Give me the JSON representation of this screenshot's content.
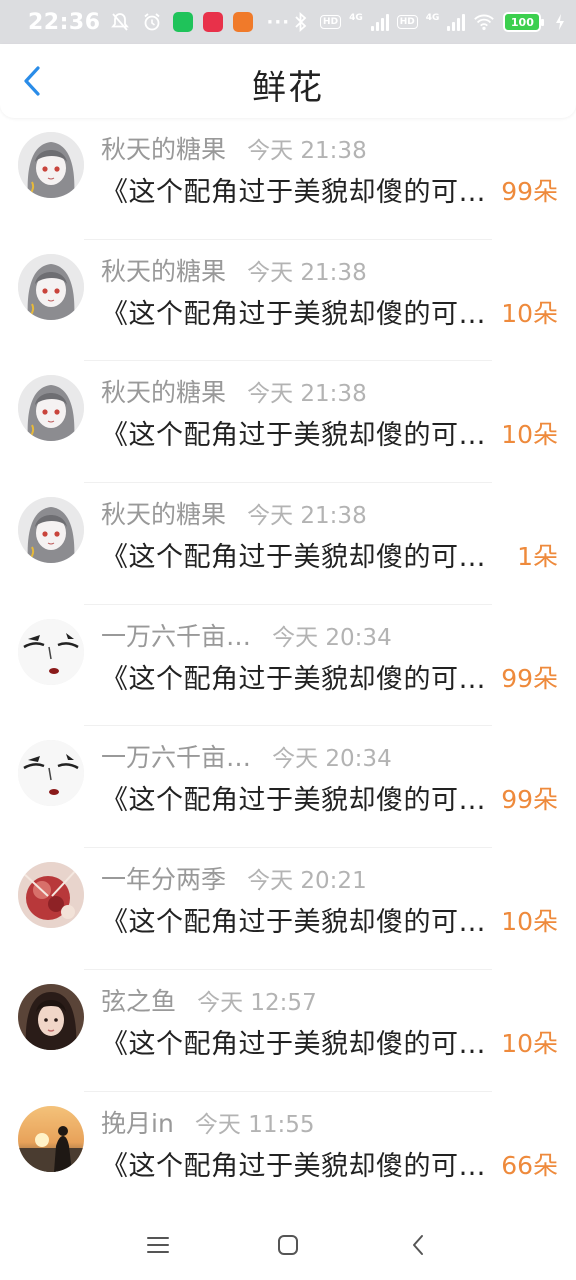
{
  "status_bar": {
    "time": "22:36",
    "battery": "100",
    "network_tags": [
      "HD",
      "HD"
    ],
    "network_gen": [
      "4G",
      "4G"
    ]
  },
  "header": {
    "title": "鲜花",
    "accent_color": "#2a8ce8"
  },
  "colors": {
    "count": "#ee8a3c",
    "name": "#999999",
    "message": "#222222"
  },
  "messages": [
    {
      "name": "秋天的糖果",
      "time": "今天 21:38",
      "text": "《这个配角过于美貌却傻的可爱》",
      "count": "99朵",
      "avatar": "anime-girl-icon"
    },
    {
      "name": "秋天的糖果",
      "time": "今天 21:38",
      "text": "《这个配角过于美貌却傻的可爱》",
      "count": "10朵",
      "avatar": "anime-girl-icon"
    },
    {
      "name": "秋天的糖果",
      "time": "今天 21:38",
      "text": "《这个配角过于美貌却傻的可爱》",
      "count": "10朵",
      "avatar": "anime-girl-icon"
    },
    {
      "name": "秋天的糖果",
      "time": "今天 21:38",
      "text": "《这个配角过于美貌却傻的可爱》",
      "count": "1朵",
      "avatar": "anime-girl-icon"
    },
    {
      "name": "一万六千亩…",
      "time": "今天 20:34",
      "text": "《这个配角过于美貌却傻的可爱》",
      "count": "99朵",
      "avatar": "face-sketch-icon"
    },
    {
      "name": "一万六千亩…",
      "time": "今天 20:34",
      "text": "《这个配角过于美貌却傻的可爱》",
      "count": "99朵",
      "avatar": "face-sketch-icon"
    },
    {
      "name": "一年分两季",
      "time": "今天 20:21",
      "text": "《这个配角过于美貌却傻的可爱》",
      "count": "10朵",
      "avatar": "red-flower-icon"
    },
    {
      "name": "弦之鱼",
      "time": "今天 12:57",
      "text": "《这个配角过于美貌却傻的可爱》",
      "count": "10朵",
      "avatar": "portrait-girl-icon"
    },
    {
      "name": "挽月in",
      "time": "今天 11:55",
      "text": "《这个配角过于美貌却傻的可爱》",
      "count": "66朵",
      "avatar": "sunset-person-icon"
    }
  ]
}
